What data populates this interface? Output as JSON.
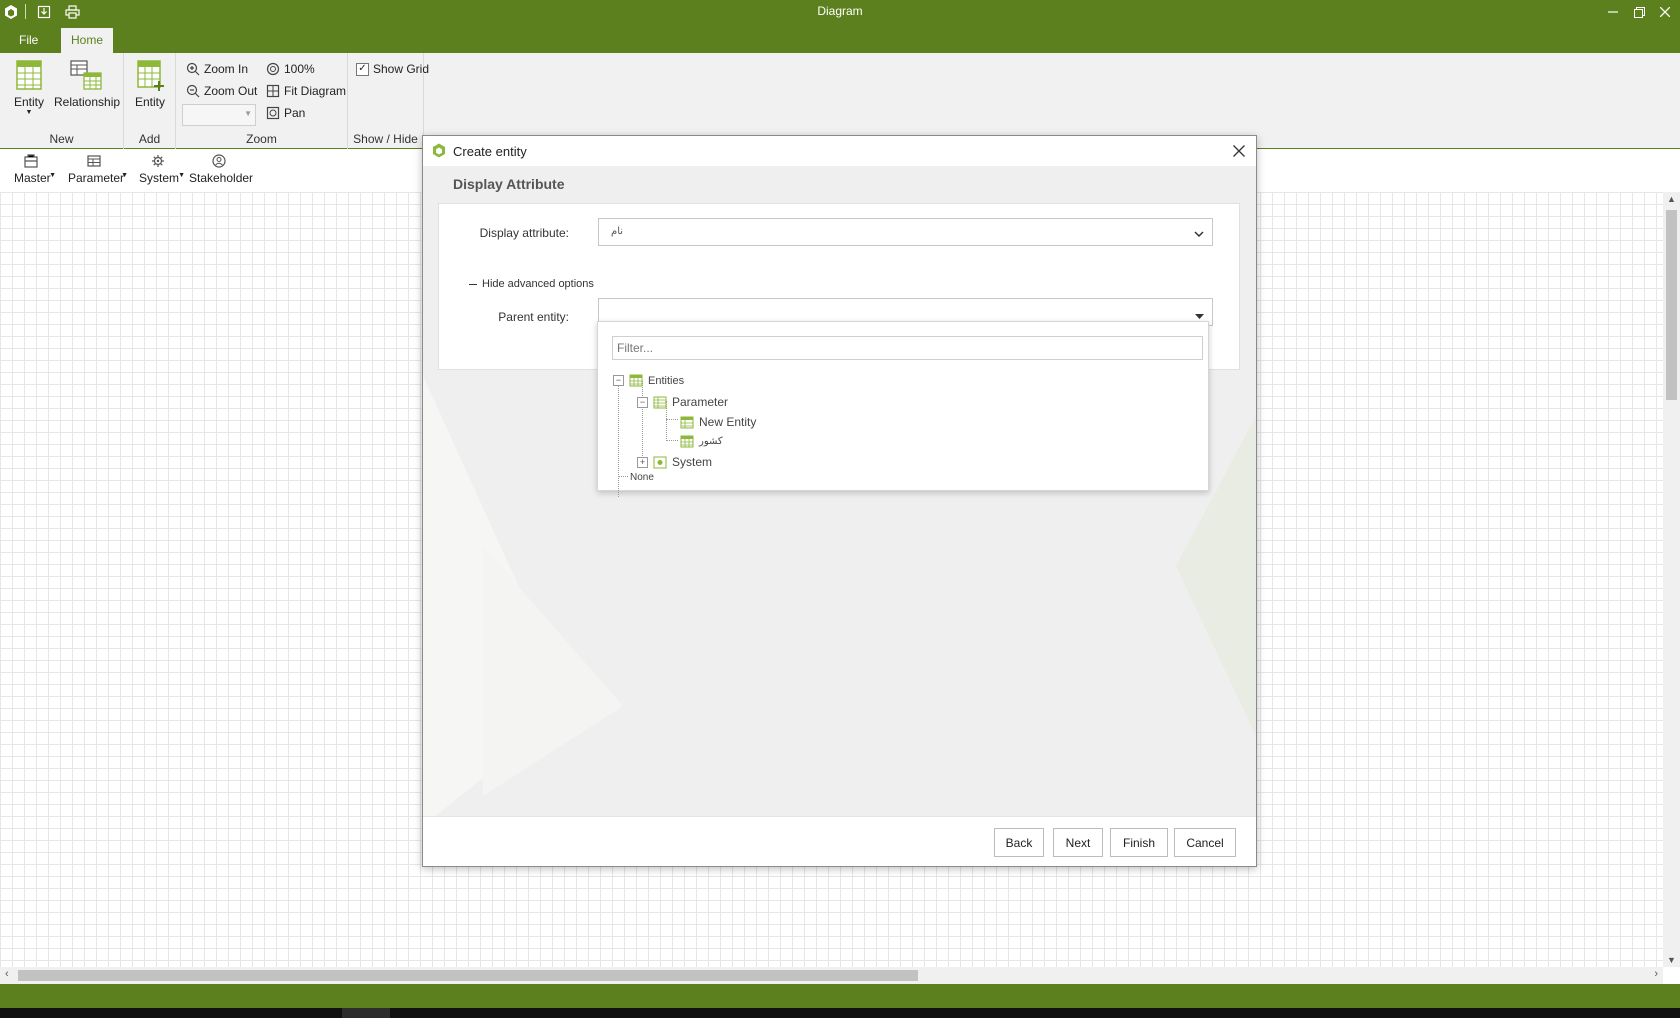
{
  "window": {
    "title": "Diagram"
  },
  "tabs": [
    {
      "label": "File"
    },
    {
      "label": "Home"
    }
  ],
  "ribbon": {
    "new_group": {
      "caption": "New",
      "entity_label": "Entity",
      "relationship_label": "Relationship"
    },
    "add_group": {
      "caption": "Add",
      "entity_label": "Entity"
    },
    "zoom_group": {
      "caption": "Zoom",
      "zoom_in": "Zoom In",
      "zoom_out": "Zoom Out",
      "zoom_100": "100%",
      "fit_diagram": "Fit Diagram",
      "pan": "Pan",
      "zoom_level_value": ""
    },
    "showhide_group": {
      "caption": "Show / Hide",
      "show_grid": "Show Grid",
      "show_grid_checked": true
    }
  },
  "toolbox": [
    {
      "label": "Master"
    },
    {
      "label": "Parameter"
    },
    {
      "label": "System"
    },
    {
      "label": "Stakeholder"
    }
  ],
  "dialog": {
    "title": "Create entity",
    "section_title": "Display Attribute",
    "display_attribute_label": "Display attribute:",
    "display_attribute_value": "نام",
    "advanced_toggle": "Hide advanced options",
    "parent_entity_label": "Parent entity:",
    "parent_entity_value": "",
    "buttons": {
      "back": "Back",
      "next": "Next",
      "finish": "Finish",
      "cancel": "Cancel"
    }
  },
  "parent_dropdown": {
    "filter_placeholder": "Filter...",
    "tree": {
      "root": "Entities",
      "parameter": "Parameter",
      "parameter_children": [
        "New Entity",
        "کشور"
      ],
      "system": "System",
      "none": "None"
    }
  },
  "colors": {
    "brand": "#5c801d",
    "icon_green": "#8db83a"
  }
}
